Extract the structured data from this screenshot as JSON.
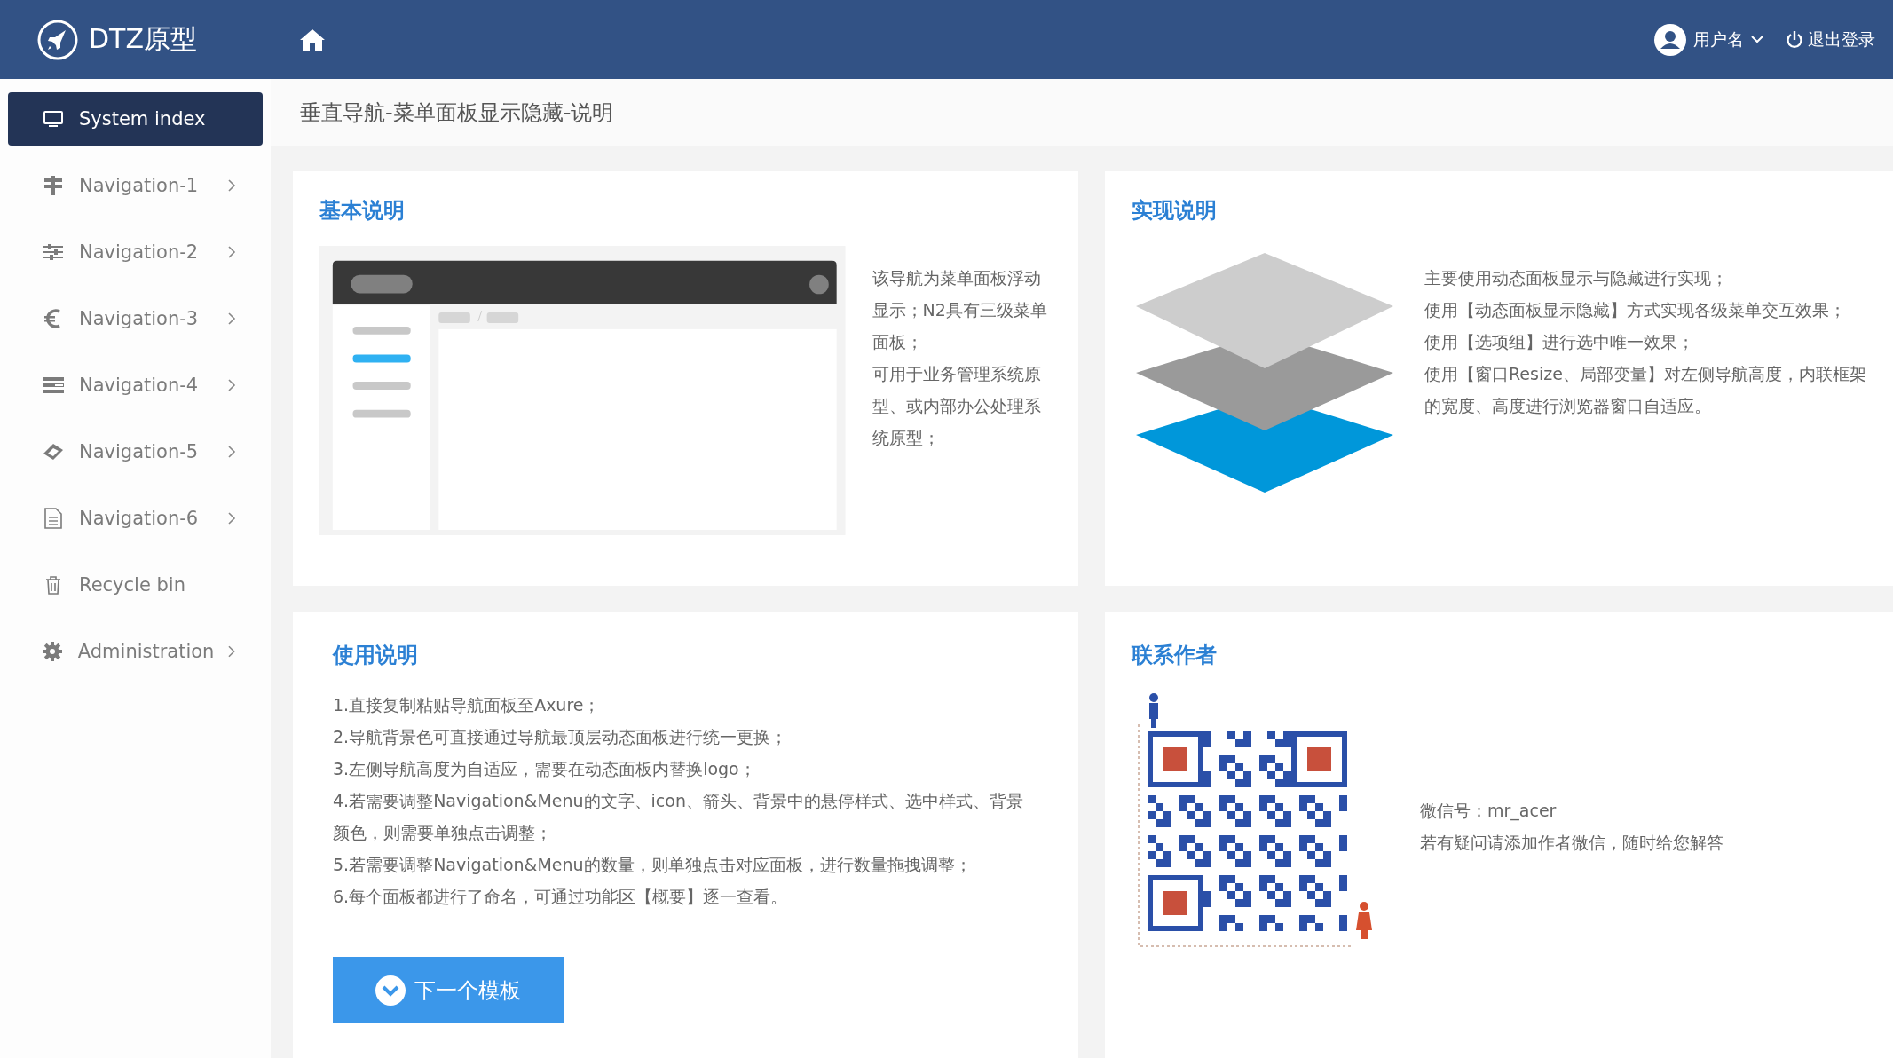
{
  "header": {
    "logo_text": "DTZ原型",
    "user_name": "用户名",
    "logout": "退出登录"
  },
  "sidebar": {
    "items": [
      {
        "label": "System index",
        "selected": true,
        "has_submenu": false
      },
      {
        "label": "Navigation-1",
        "selected": false,
        "has_submenu": true
      },
      {
        "label": "Navigation-2",
        "selected": false,
        "has_submenu": true
      },
      {
        "label": "Navigation-3",
        "selected": false,
        "has_submenu": true
      },
      {
        "label": "Navigation-4",
        "selected": false,
        "has_submenu": true
      },
      {
        "label": "Navigation-5",
        "selected": false,
        "has_submenu": true
      },
      {
        "label": "Navigation-6",
        "selected": false,
        "has_submenu": true
      },
      {
        "label": "Recycle bin",
        "selected": false,
        "has_submenu": false
      },
      {
        "label": "Administration",
        "selected": false,
        "has_submenu": true
      }
    ]
  },
  "page_title": "垂直导航-菜单面板显示隐藏-说明",
  "cards": {
    "basic": {
      "title": "基本说明",
      "paragraphs": [
        "该导航为菜单面板浮动显示；N2具有三级菜单面板；",
        "可用于业务管理系统原型、或内部办公处理系统原型；"
      ]
    },
    "implementation": {
      "title": "实现说明",
      "paragraphs": [
        "主要使用动态面板显示与隐藏进行实现；",
        "使用【动态面板显示隐藏】方式实现各级菜单交互效果；",
        "使用【选项组】进行选中唯一效果；",
        "使用【窗口Resize、局部变量】对左侧导航高度，内联框架的宽度、高度进行浏览器窗口自适应。"
      ]
    },
    "usage": {
      "title": "使用说明",
      "steps": [
        "1.直接复制粘贴导航面板至Axure；",
        "2.导航背景色可直接通过导航最顶层动态面板进行统一更换；",
        "3.左侧导航高度为自适应，需要在动态面板内替换logo；",
        "4.若需要调整Navigation&Menu的文字、icon、箭头、背景中的悬停样式、选中样式、背景颜色，则需要单独点击调整；",
        "5.若需要调整Navigation&Menu的数量，则单独点击对应面板，进行数量拖拽调整；",
        "6.每个面板都进行了命名，可通过功能区【概要】逐一查看。"
      ],
      "button": "下一个模板"
    },
    "contact": {
      "title": "联系作者",
      "lines": [
        "微信号：mr_acer",
        "若有疑问请添加作者微信，随时给您解答"
      ]
    }
  }
}
